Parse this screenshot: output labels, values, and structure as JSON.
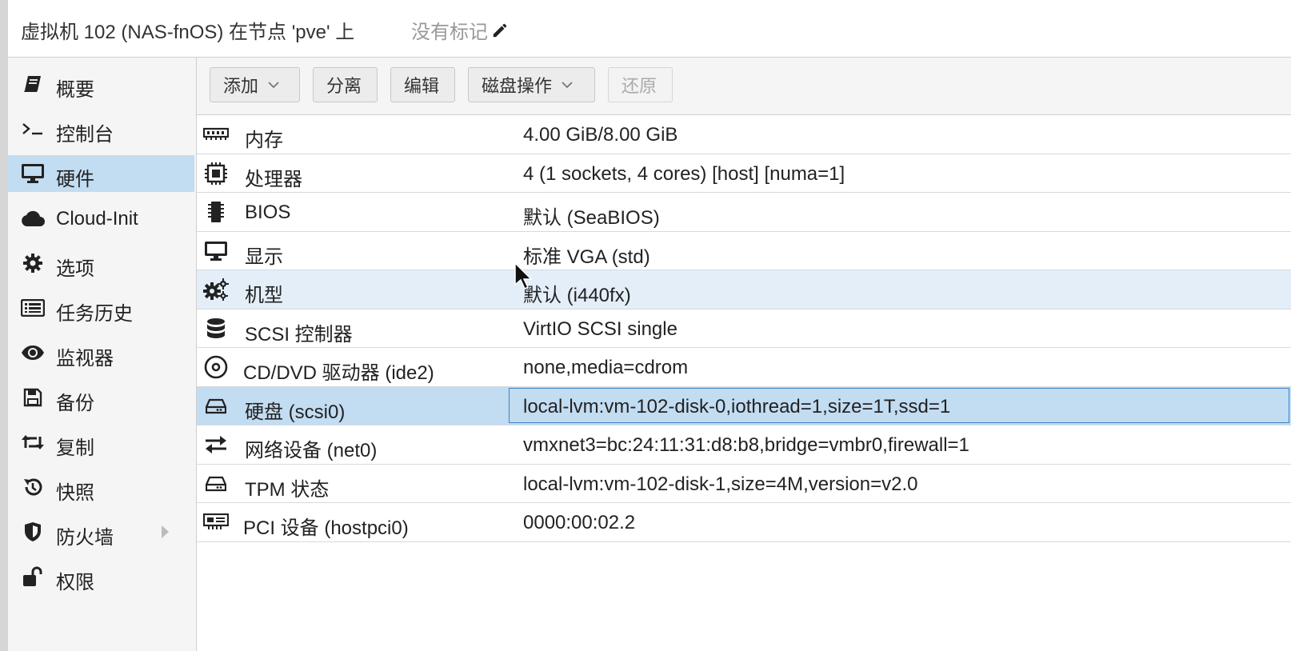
{
  "header": {
    "title": "虚拟机 102 (NAS-fnOS) 在节点 'pve' 上",
    "tags_label": "没有标记",
    "edit_icon": "pencil-icon"
  },
  "sidebar": {
    "items": [
      {
        "label": "概要",
        "icon": "book-icon"
      },
      {
        "label": "控制台",
        "icon": "terminal-icon"
      },
      {
        "label": "硬件",
        "icon": "monitor-icon",
        "active": true
      },
      {
        "label": "Cloud-Init",
        "icon": "cloud-icon"
      },
      {
        "label": "选项",
        "icon": "gear-icon"
      },
      {
        "label": "任务历史",
        "icon": "list-icon"
      },
      {
        "label": "监视器",
        "icon": "eye-icon"
      },
      {
        "label": "备份",
        "icon": "floppy-icon"
      },
      {
        "label": "复制",
        "icon": "retweet-icon"
      },
      {
        "label": "快照",
        "icon": "history-icon"
      },
      {
        "label": "防火墙",
        "icon": "shield-icon",
        "has_submenu": true
      },
      {
        "label": "权限",
        "icon": "unlock-icon"
      }
    ]
  },
  "toolbar": {
    "add": "添加",
    "detach": "分离",
    "edit": "编辑",
    "disk_action": "磁盘操作",
    "revert": "还原"
  },
  "hardware": [
    {
      "name": "内存",
      "value": "4.00 GiB/8.00 GiB",
      "icon": "memory-icon"
    },
    {
      "name": "处理器",
      "value": "4 (1 sockets, 4 cores) [host] [numa=1]",
      "icon": "cpu-icon"
    },
    {
      "name": "BIOS",
      "value": "默认 (SeaBIOS)",
      "icon": "microchip-icon"
    },
    {
      "name": "显示",
      "value": "标准 VGA (std)",
      "icon": "desktop-icon"
    },
    {
      "name": "机型",
      "value": "默认 (i440fx)",
      "icon": "cogs-icon"
    },
    {
      "name": "SCSI 控制器",
      "value": "VirtIO SCSI single",
      "icon": "database-icon"
    },
    {
      "name": "CD/DVD 驱动器 (ide2)",
      "value": "none,media=cdrom",
      "icon": "cdrom-icon"
    },
    {
      "name": "硬盘 (scsi0)",
      "value": "local-lvm:vm-102-disk-0,iothread=1,size=1T,ssd=1",
      "icon": "hdd-icon"
    },
    {
      "name": "网络设备 (net0)",
      "value": "vmxnet3=bc:24:11:31:d8:b8,bridge=vmbr0,firewall=1",
      "icon": "exchange-icon"
    },
    {
      "name": "TPM 状态",
      "value": "local-lvm:vm-102-disk-1,size=4M,version=v2.0",
      "icon": "hdd-icon"
    },
    {
      "name": "PCI 设备 (hostpci0)",
      "value": "0000:00:02.2",
      "icon": "pci-card-icon"
    }
  ],
  "colors": {
    "selection": "#c2dcf2",
    "hover": "#e3eef8",
    "focus_border": "#3b83c9"
  }
}
